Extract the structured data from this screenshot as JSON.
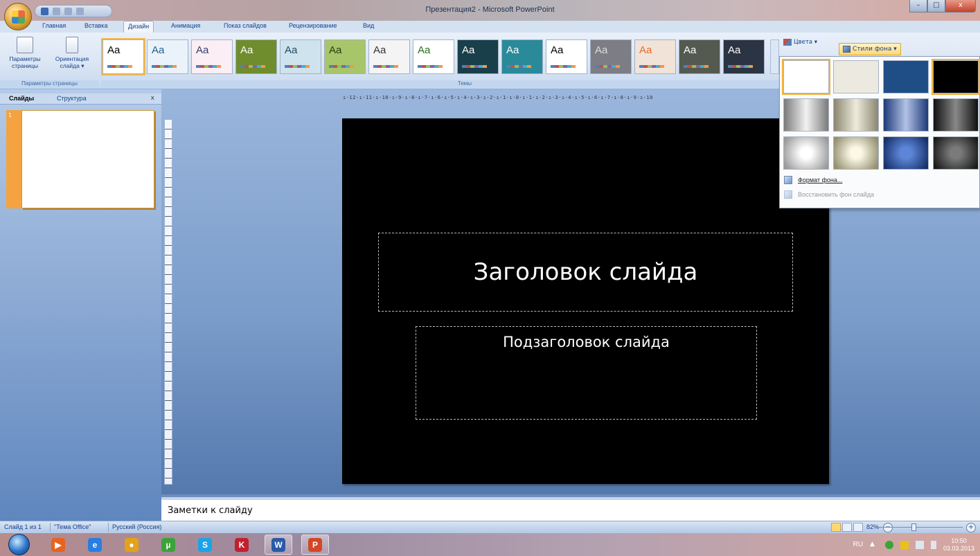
{
  "window": {
    "title": "Презентация2 - Microsoft PowerPoint",
    "minimize": "–",
    "maximize": "□",
    "close": "x"
  },
  "ribbon_tabs": [
    {
      "label": "Главная"
    },
    {
      "label": "Вставка"
    },
    {
      "label": "Дизайн",
      "active": true
    },
    {
      "label": "Анимация"
    },
    {
      "label": "Показ слайдов"
    },
    {
      "label": "Рецензирование"
    },
    {
      "label": "Вид"
    }
  ],
  "ribbon": {
    "page_setup_label_line1": "Параметры",
    "page_setup_label_line2": "страницы",
    "orientation_label_line1": "Ориентация",
    "orientation_label_line2": "слайда ▾",
    "group_page_setup": "Параметры страницы",
    "group_themes": "Темы",
    "theme_sample": "Aa",
    "colors_label": "Цвета ▾",
    "background_styles_label": "Стили фона ▾"
  },
  "themes": [
    {
      "bg": "#ffffff",
      "fg": "#000000"
    },
    {
      "bg": "#eaf3fa",
      "fg": "#1f5f8b"
    },
    {
      "bg": "#fbeef4",
      "fg": "#3a3a6a"
    },
    {
      "bg": "#6f8d2c",
      "fg": "#ffffff"
    },
    {
      "bg": "#cfe3ee",
      "fg": "#1e4a62"
    },
    {
      "bg": "#a7c66a",
      "fg": "#2a3a10"
    },
    {
      "bg": "#f4f4f4",
      "fg": "#333333"
    },
    {
      "bg": "#ffffff",
      "fg": "#2a6b1e"
    },
    {
      "bg": "#183f4a",
      "fg": "#ffffff"
    },
    {
      "bg": "#2a8a9a",
      "fg": "#ffffff"
    },
    {
      "bg": "#ffffff",
      "fg": "#000000"
    },
    {
      "bg": "#7d7d85",
      "fg": "#dddddd"
    },
    {
      "bg": "#f1e3d8",
      "fg": "#e86a2a"
    },
    {
      "bg": "#555a50",
      "fg": "#ffffff"
    },
    {
      "bg": "#2b3442",
      "fg": "#ffffff"
    }
  ],
  "left_panel": {
    "tab_slides": "Слайды",
    "tab_outline": "Структура",
    "close": "x",
    "slide_number": "1"
  },
  "ruler": {
    "horizontal": "ı·12·ı·11·ı·10·ı·9·ı·8·ı·7·ı·6·ı·5·ı·4·ı·3·ı·2·ı·1·ı·0·ı·1·ı·2·ı·3·ı·4·ı·5·ı·6·ı·7·ı·8·ı·9·ı·10"
  },
  "slide": {
    "title": "Заголовок слайда",
    "subtitle": "Подзаголовок слайда"
  },
  "background_styles": {
    "swatches": [
      {
        "css": "#ffffff",
        "selected": true
      },
      {
        "css": "#ece9e0"
      },
      {
        "css": "#1f4e86"
      },
      {
        "css": "#000000",
        "selected": true
      },
      {
        "css": "linear-gradient(90deg,#7a7a7a,#f2f2f2 50%,#7a7a7a)"
      },
      {
        "css": "linear-gradient(90deg,#8a8670,#eeebdc 50%,#8a8670)"
      },
      {
        "css": "linear-gradient(90deg,#1e3a78,#b2c2e6 50%,#1e3a78)"
      },
      {
        "css": "linear-gradient(90deg,#101010,#888888 50%,#101010)"
      },
      {
        "css": "radial-gradient(circle,#ffffff 20%,#9a9a9a 90%)"
      },
      {
        "css": "radial-gradient(circle,#fbf8e6 20%,#948f70 90%)"
      },
      {
        "css": "radial-gradient(circle,#5d86d8 20%,#16306a 90%)"
      },
      {
        "css": "radial-gradient(circle,#7a7a7a 20%,#1a1a1a 90%)"
      }
    ],
    "format_background": "Формат фона...",
    "reset_background": "Восстановить фон слайда"
  },
  "notes": {
    "placeholder": "Заметки к слайду"
  },
  "status": {
    "slide_count": "Слайд 1 из 1",
    "theme": "\"Тема Office\"",
    "language": "Русский (Россия)",
    "zoom": "82%",
    "zoom_out": "−",
    "zoom_in": "+"
  },
  "taskbar": {
    "apps": [
      {
        "glyph": "▶",
        "color": "#e8631f"
      },
      {
        "glyph": "e",
        "color": "#2a7de1"
      },
      {
        "glyph": "●",
        "color": "#e3a21a"
      },
      {
        "glyph": "µ",
        "color": "#3aa33a"
      },
      {
        "glyph": "S",
        "color": "#1aa3e8"
      },
      {
        "glyph": "K",
        "color": "#c2202d"
      },
      {
        "glyph": "W",
        "color": "#2a5aa8"
      },
      {
        "glyph": "P",
        "color": "#d24726"
      }
    ],
    "language": "RU",
    "time": "10:50",
    "date": "03.03.2013"
  }
}
